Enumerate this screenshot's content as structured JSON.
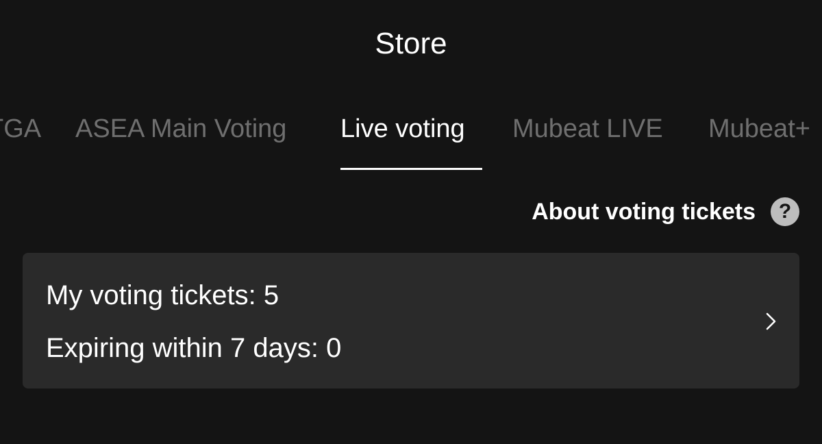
{
  "header": {
    "title": "Store"
  },
  "tabs": [
    {
      "label": "TGA",
      "active": false
    },
    {
      "label": "ASEA Main Voting",
      "active": false
    },
    {
      "label": "Live voting",
      "active": true
    },
    {
      "label": "Mubeat LIVE",
      "active": false
    },
    {
      "label": "Mubeat+",
      "active": false
    }
  ],
  "about": {
    "label": "About voting tickets",
    "icon": "question-circle-icon"
  },
  "tickets": {
    "my_tickets": "My voting tickets: 5",
    "expiring": "Expiring within 7 days: 0",
    "icon": "chevron-right-icon"
  },
  "colors": {
    "background": "#141414",
    "card": "#2a2a2a",
    "inactive_tab": "#6f6f6f",
    "active_tab": "#ffffff"
  }
}
